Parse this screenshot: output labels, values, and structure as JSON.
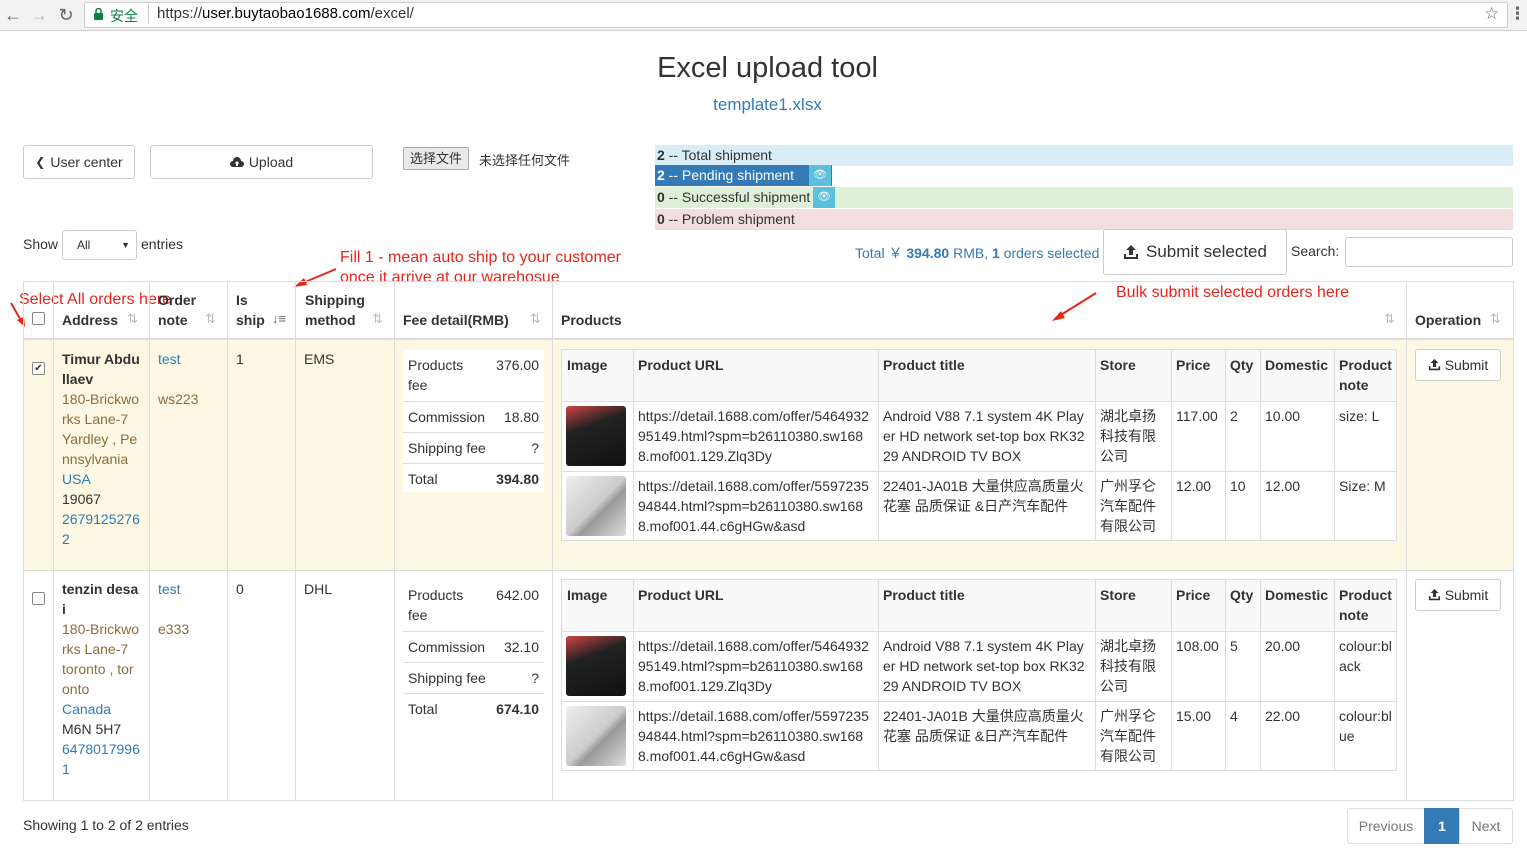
{
  "browser": {
    "secure_label": "安全",
    "url_scheme": "https://",
    "url_host": "user.buytaobao1688.com",
    "url_path": "/excel/"
  },
  "header": {
    "title": "Excel upload tool",
    "template_link": "template1.xlsx"
  },
  "toolbar": {
    "user_center": "User center",
    "upload": "Upload",
    "choose_file": "选择文件",
    "no_file": "未选择任何文件"
  },
  "stats": {
    "total": {
      "count": "2",
      "label": " -- Total shipment"
    },
    "pending": {
      "count": "2",
      "label": " -- Pending shipment"
    },
    "success": {
      "count": "0",
      "label": " -- Successful shipment"
    },
    "problem": {
      "count": "0",
      "label": " -- Problem shipment"
    }
  },
  "length_menu": {
    "show": "Show",
    "value": "All",
    "entries": "entries"
  },
  "annotations": {
    "fill_line1": "Fill 1 - mean auto ship to your customer",
    "fill_line2": "once it arrive at our warehosue",
    "select_all": "Select All orders here",
    "bulk_submit": "Bulk submit selected orders here"
  },
  "summary": {
    "total_prefix": "Total ￥",
    "total_amount": "394.80",
    "currency": "RMB,",
    "selected_count": "1",
    "selected_suffix": "orders selected"
  },
  "submit_selected": "Submit selected",
  "search": {
    "label": "Search:",
    "value": ""
  },
  "columns": {
    "address": "Address",
    "order_note_1": "Order",
    "order_note_2": "note",
    "is_ship_1": "Is",
    "is_ship_2": "ship",
    "shipping_1": "Shipping",
    "shipping_2": "method",
    "fee": "Fee detail(RMB)",
    "products": "Products",
    "operation": "Operation"
  },
  "inner_columns": {
    "image": "Image",
    "url": "Product URL",
    "title": "Product title",
    "store": "Store",
    "price": "Price",
    "qty": "Qty",
    "domestic": "Domestic",
    "note_1": "Product",
    "note_2": "note"
  },
  "fee_labels": {
    "products_fee_1": "Products",
    "products_fee_2": "fee",
    "commission": "Commission",
    "shipping_fee": "Shipping fee",
    "total": "Total"
  },
  "operation_label": "Submit",
  "orders": [
    {
      "checked": true,
      "name_1": "Timur Abdu",
      "name_2": "llaev",
      "addr": [
        "180-Brickwo",
        "rks Lane-7"
      ],
      "city": [
        "Yardley , Pe",
        "nnsylvania"
      ],
      "country": "USA",
      "zip": "19067",
      "phone": [
        "2679125276",
        "2"
      ],
      "note": "test",
      "note_code": "ws223",
      "is_ship": "1",
      "method": "EMS",
      "fee": {
        "products": "376.00",
        "commission": "18.80",
        "shipping": "?",
        "total": "394.80"
      },
      "items": [
        {
          "url": [
            "https://detail.1688.com/offer/5464932",
            "95149.html?spm=b26110380.sw168",
            "8.mof001.129.Zlq3Dy"
          ],
          "title": [
            "Android V88 7.1 system 4K Play",
            "er HD network set-top box RK32",
            "29 ANDROID TV BOX"
          ],
          "store": [
            "湖北卓扬",
            "科技有限",
            "公司"
          ],
          "price": "117.00",
          "qty": "2",
          "domestic": "10.00",
          "note": [
            "size: L"
          ]
        },
        {
          "url": [
            "https://detail.1688.com/offer/5597235",
            "94844.html?spm=b26110380.sw168",
            "8.mof001.44.c6gHGw&asd"
          ],
          "title": [
            "22401-JA01B 大量供应高质量火",
            "花塞 品质保证 &日产汽车配件"
          ],
          "store": [
            "广州孚仑",
            "汽车配件",
            "有限公司"
          ],
          "price": "12.00",
          "qty": "10",
          "domestic": "12.00",
          "note": [
            "Size: M"
          ]
        }
      ]
    },
    {
      "checked": false,
      "name_1": "tenzin desa",
      "name_2": "i",
      "addr": [
        "180-Brickwo",
        "rks Lane-7"
      ],
      "city": [
        "toronto , tor",
        "onto"
      ],
      "country": "Canada",
      "zip": "M6N 5H7",
      "phone": [
        "6478017996",
        "1"
      ],
      "note": "test",
      "note_code": "e333",
      "is_ship": "0",
      "method": "DHL",
      "fee": {
        "products": "642.00",
        "commission": "32.10",
        "shipping": "?",
        "total": "674.10"
      },
      "items": [
        {
          "url": [
            "https://detail.1688.com/offer/5464932",
            "95149.html?spm=b26110380.sw168",
            "8.mof001.129.Zlq3Dy"
          ],
          "title": [
            "Android V88 7.1 system 4K Play",
            "er HD network set-top box RK32",
            "29 ANDROID TV BOX"
          ],
          "store": [
            "湖北卓扬",
            "科技有限",
            "公司"
          ],
          "price": "108.00",
          "qty": "5",
          "domestic": "20.00",
          "note": [
            "colour:bl",
            "ack"
          ]
        },
        {
          "url": [
            "https://detail.1688.com/offer/5597235",
            "94844.html?spm=b26110380.sw168",
            "8.mof001.44.c6gHGw&asd"
          ],
          "title": [
            "22401-JA01B 大量供应高质量火",
            "花塞 品质保证 &日产汽车配件"
          ],
          "store": [
            "广州孚仑",
            "汽车配件",
            "有限公司"
          ],
          "price": "15.00",
          "qty": "4",
          "domestic": "22.00",
          "note": [
            "colour:bl",
            "ue"
          ]
        }
      ]
    }
  ],
  "footer": {
    "showing": "Showing 1 to 2 of 2 entries",
    "previous": "Previous",
    "page": "1",
    "next": "Next"
  }
}
